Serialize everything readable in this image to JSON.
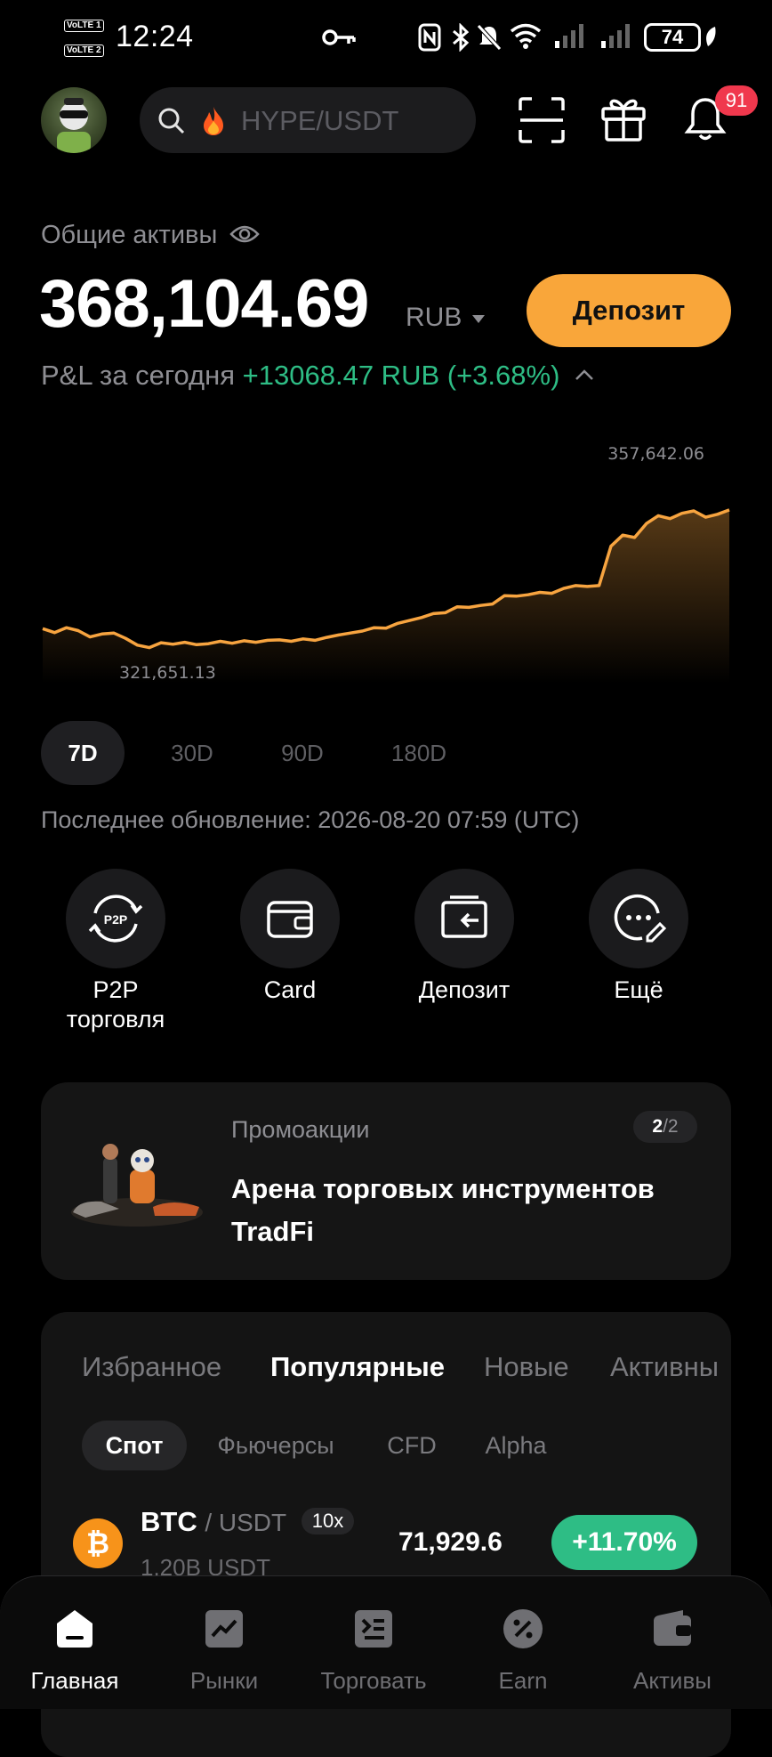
{
  "status_bar": {
    "time": "12:24",
    "sim1": "VoLTE 1",
    "sim2": "VoLTE 2",
    "battery": "74"
  },
  "header": {
    "search_placeholder": "HYPE/USDT",
    "notifications_count": "91"
  },
  "assets": {
    "label": "Общие активы",
    "balance": "368,104.69",
    "currency": "RUB",
    "deposit_button": "Депозит",
    "pnl_label": "P&L за сегодня",
    "pnl_value": "+13068.47 RUB (+3.68%)"
  },
  "chart_data": {
    "type": "area",
    "max_label": "357,642.06",
    "min_label": "321,651.13",
    "color": "#f7a440",
    "values": [
      327100,
      326300,
      327300,
      326700,
      325400,
      326000,
      326200,
      325100,
      323700,
      323200,
      324200,
      323900,
      324300,
      323800,
      324000,
      324500,
      324100,
      324600,
      324300,
      324700,
      324800,
      324500,
      325000,
      324700,
      325300,
      325800,
      326200,
      326600,
      327300,
      327200,
      328200,
      328800,
      329400,
      330200,
      330400,
      331600,
      331500,
      331900,
      332200,
      333900,
      333800,
      334100,
      334600,
      334400,
      335400,
      336000,
      335800,
      336000,
      344100,
      346400,
      345900,
      348800,
      350400,
      349800,
      350900,
      351400,
      350100,
      350700,
      351600
    ]
  },
  "ranges": [
    "7D",
    "30D",
    "90D",
    "180D"
  ],
  "active_range": "7D",
  "last_update": "Последнее обновление: 2026-08-20 07:59 (UTC)",
  "quick_actions": [
    {
      "label": "P2P\nторговля",
      "icon": "p2p-icon"
    },
    {
      "label": "Card",
      "icon": "card-icon"
    },
    {
      "label": "Депозит",
      "icon": "deposit-icon"
    },
    {
      "label": "Ещё",
      "icon": "more-icon"
    }
  ],
  "promo": {
    "kicker": "Промоакции",
    "title": "Арена торговых инструментов TradFi",
    "index": "2",
    "total": "/2"
  },
  "markets": {
    "tabs": [
      "Избранное",
      "Популярные",
      "Новые",
      "Активны"
    ],
    "active_tab": "Популярные",
    "subtabs": [
      "Спот",
      "Фьючерсы",
      "CFD",
      "Alpha"
    ],
    "active_subtab": "Спот",
    "rows": [
      {
        "base": "BTC",
        "quote": "/ USDT",
        "leverage": "10x",
        "volume": "1.20B USDT",
        "price": "71,929.6",
        "change": "+11.70%"
      }
    ]
  },
  "nav": [
    {
      "label": "Главная",
      "icon": "home-icon"
    },
    {
      "label": "Рынки",
      "icon": "markets-icon"
    },
    {
      "label": "Торговать",
      "icon": "trade-icon"
    },
    {
      "label": "Earn",
      "icon": "earn-icon"
    },
    {
      "label": "Активы",
      "icon": "wallet-icon"
    }
  ],
  "colors": {
    "accent": "#f9a63a",
    "positive": "#2ebd85",
    "badge": "#f0384d"
  }
}
